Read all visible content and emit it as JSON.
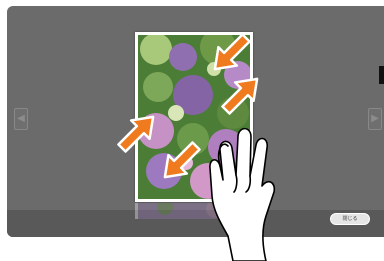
{
  "viewer": {
    "prev_icon": "chevron-left-icon",
    "next_icon": "chevron-right-icon",
    "prev_glyph": "◀",
    "next_glyph": "▶",
    "close_label": "閉じる"
  },
  "gesture": {
    "type": "pinch",
    "hand_icon": "hand-pinch-icon",
    "arrow_color": "#f07a1e",
    "arrow_outline": "#ffffff"
  },
  "colors": {
    "screen_bg": "#6b6b6b",
    "bottom_bar": "#595959",
    "photo_green": "#5c8f3a",
    "photo_purple": "#9b7ab8",
    "photo_pink": "#c790c0"
  }
}
